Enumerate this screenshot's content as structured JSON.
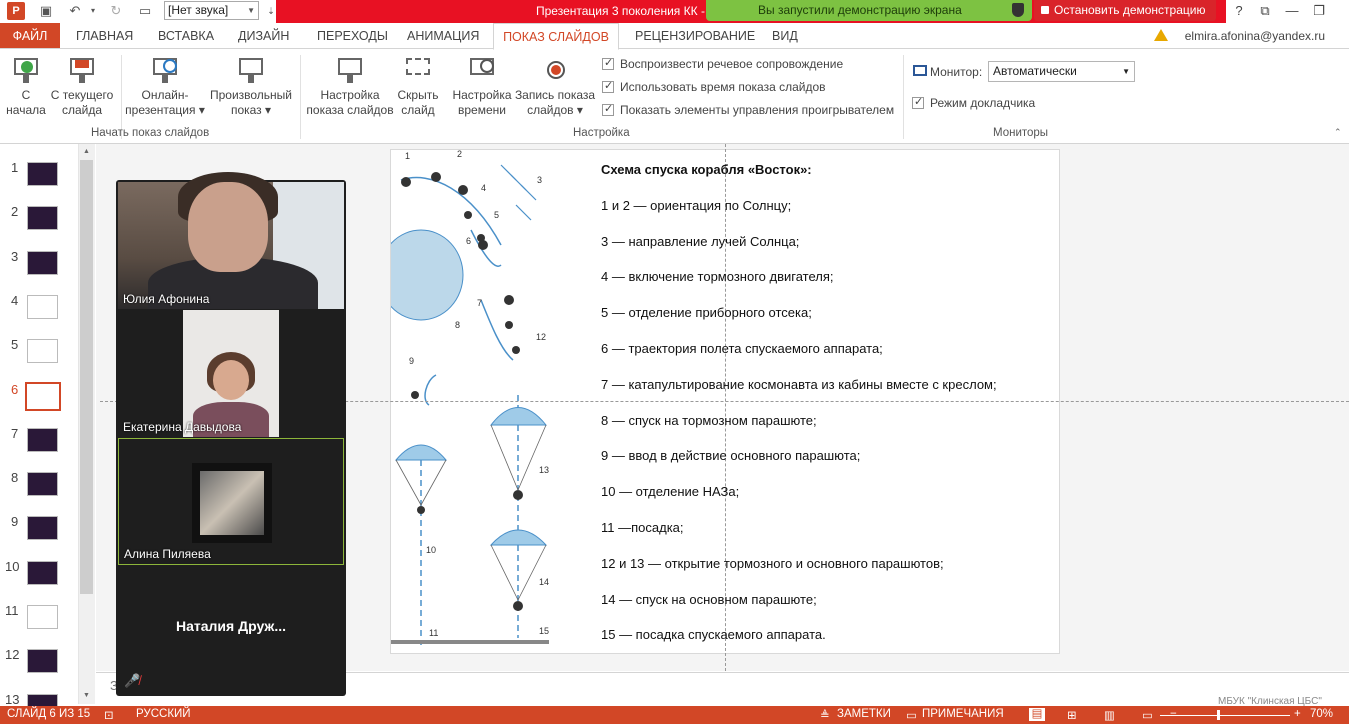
{
  "titlebar": {
    "sound_select": "[Нет звука]",
    "doc_title": "Презентация 3 поколения КК -",
    "share_banner": "Вы запустили демонстрацию экрана",
    "stop_share": "Остановить демонстрацию",
    "help": "?",
    "restore": "⧉",
    "minimize": "—",
    "maximize": "❐"
  },
  "tabs": {
    "file": "ФАЙЛ",
    "items": [
      "ГЛАВНАЯ",
      "ВСТАВКА",
      "ДИЗАЙН",
      "ПЕРЕХОДЫ",
      "АНИМАЦИЯ",
      "ПОКАЗ СЛАЙДОВ",
      "РЕЦЕНЗИРОВАНИЕ",
      "ВИД"
    ],
    "active_index": 5,
    "user_email": "elmira.afonina@yandex.ru"
  },
  "ribbon": {
    "start_group": {
      "label": "Начать показ слайдов",
      "from_start": [
        "С",
        "начала"
      ],
      "from_current": [
        "С текущего",
        "слайда"
      ],
      "online": [
        "Онлайн-",
        "презентация ▾"
      ],
      "custom": [
        "Произвольный",
        "показ ▾"
      ]
    },
    "setup_group": {
      "label": "Настройка",
      "setup": [
        "Настройка",
        "показа слайдов"
      ],
      "hide": [
        "Скрыть",
        "слайд"
      ],
      "timings": [
        "Настройка",
        "времени"
      ],
      "record": [
        "Запись показа",
        "слайдов ▾"
      ],
      "checkboxes": [
        "Воспроизвести речевое сопровождение",
        "Использовать время показа слайдов",
        "Показать элементы управления проигрывателем"
      ]
    },
    "monitors_group": {
      "label": "Мониторы",
      "monitor_label": "Монитор:",
      "monitor_value": "Автоматически",
      "presenter_view": "Режим докладчика"
    }
  },
  "thumbnails": {
    "numbers": [
      "1",
      "2",
      "3",
      "4",
      "5",
      "6",
      "7",
      "8",
      "9",
      "10",
      "11",
      "12",
      "13"
    ],
    "active": 6
  },
  "slide": {
    "title": "Схема спуска корабля «Восток»:",
    "lines": [
      "1 и 2 — ориентация по Солнцу;",
      "3 — направление лучей Солнца;",
      "4 — включение тормозного двигателя;",
      "5 — отделение приборного отсека;",
      "6 — траектория полета спускаемого аппарата;",
      "7 — катапультирование космонавта из кабины вместе с креслом;",
      "8 — спуск на тормозном парашюте;",
      "9 — ввод в действие основного парашюта;",
      "10 — отделение НАЗа;",
      "11 —посадка;",
      "12 и 13 — открытие тормозного и основного парашютов;",
      "14 — спуск на основном парашюте;",
      "15 — посадка спускаемого аппарата."
    ],
    "diagram_labels": [
      "1",
      "2",
      "3",
      "4",
      "5",
      "6",
      "7",
      "8",
      "9",
      "10",
      "11",
      "12",
      "13",
      "14",
      "15"
    ]
  },
  "notes": {
    "text": "За"
  },
  "video": {
    "participants": [
      "Юлия Афонина",
      "Екатерина Давыдова",
      "Алина Пиляева",
      "Наталия  Друж..."
    ]
  },
  "statusbar": {
    "slide_counter": "СЛАЙД 6 ИЗ 15",
    "language": "РУССКИЙ",
    "notes": "ЗАМЕТКИ",
    "comments": "ПРИМЕЧАНИЯ",
    "zoom": "70%"
  },
  "watermark": "МБУК \"Клинская ЦБС\""
}
